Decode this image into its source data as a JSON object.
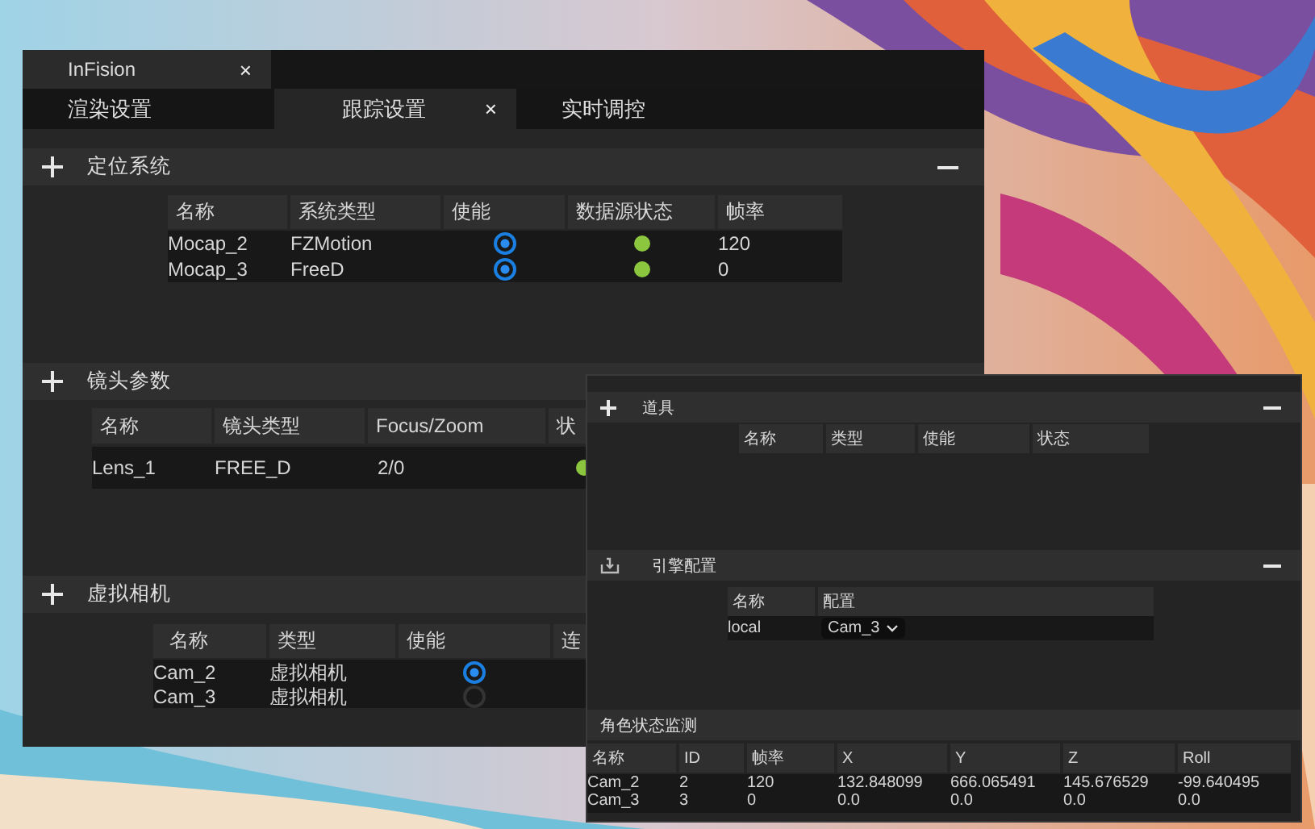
{
  "window": {
    "tab": {
      "label": "InFision",
      "close": "×"
    },
    "tabs": [
      {
        "label": "渲染设置",
        "selected": false
      },
      {
        "label": "跟踪设置",
        "selected": true,
        "close": "×"
      },
      {
        "label": "实时调控",
        "selected": false
      }
    ],
    "sections": [
      {
        "kind": "positioning",
        "title": "定位系统",
        "table": {
          "columns": [
            "名称",
            "系统类型",
            "使能",
            "数据源状态",
            "帧率"
          ],
          "rows": [
            {
              "cells": [
                {
                  "kind": "text",
                  "text": "Mocap_2"
                },
                {
                  "kind": "text",
                  "text": "FZMotion"
                },
                {
                  "kind": "radio",
                  "on": true
                },
                {
                  "kind": "dot",
                  "color": "#8cc63f"
                },
                {
                  "kind": "text",
                  "text": "120"
                }
              ]
            },
            {
              "cells": [
                {
                  "kind": "text",
                  "text": "Mocap_3"
                },
                {
                  "kind": "text",
                  "text": "FreeD"
                },
                {
                  "kind": "radio",
                  "on": true
                },
                {
                  "kind": "dot",
                  "color": "#8cc63f"
                },
                {
                  "kind": "text",
                  "text": "0"
                }
              ]
            }
          ]
        }
      },
      {
        "kind": "lens",
        "title": "镜头参数",
        "table": {
          "columns": [
            "名称",
            "镜头类型",
            "Focus/Zoom",
            "状"
          ],
          "rows": [
            {
              "cells": [
                {
                  "kind": "text",
                  "text": "Lens_1"
                },
                {
                  "kind": "text",
                  "text": "FREE_D"
                },
                {
                  "kind": "text",
                  "text": "2/0"
                },
                {
                  "kind": "dot",
                  "color": "#8cc63f"
                }
              ]
            }
          ]
        }
      },
      {
        "kind": "camera",
        "title": "虚拟相机",
        "table": {
          "columns": [
            "名称",
            "类型",
            "使能",
            "连"
          ],
          "rows": [
            {
              "cells": [
                {
                  "kind": "text",
                  "text": "Cam_2"
                },
                {
                  "kind": "text",
                  "text": "虚拟相机"
                },
                {
                  "kind": "radio",
                  "on": true
                }
              ]
            },
            {
              "cells": [
                {
                  "kind": "text",
                  "text": "Cam_3"
                },
                {
                  "kind": "text",
                  "text": "虚拟相机"
                },
                {
                  "kind": "radio",
                  "on": false
                }
              ]
            }
          ]
        }
      }
    ]
  },
  "panel": {
    "sections": [
      {
        "kind": "props",
        "title": "道具",
        "table": {
          "columns": [
            "名称",
            "类型",
            "使能",
            "状态"
          ]
        }
      },
      {
        "kind": "engine",
        "title": "引擎配置",
        "table": {
          "columns": [
            "名称",
            "配置"
          ],
          "rows": [
            {
              "cells": [
                {
                  "kind": "text",
                  "text": "local"
                },
                {
                  "kind": "dropdown",
                  "value": "Cam_3"
                }
              ]
            }
          ]
        }
      },
      {
        "kind": "monitor",
        "title": "角色状态监测",
        "table": {
          "columns": [
            "名称",
            "ID",
            "帧率",
            "X",
            "Y",
            "Z",
            "Roll"
          ],
          "rows": [
            {
              "cells": [
                {
                  "kind": "text",
                  "text": "Cam_2"
                },
                {
                  "kind": "text",
                  "text": "2"
                },
                {
                  "kind": "text",
                  "text": "120"
                },
                {
                  "kind": "text",
                  "text": "132.848099"
                },
                {
                  "kind": "text",
                  "text": "666.065491"
                },
                {
                  "kind": "text",
                  "text": "145.676529"
                },
                {
                  "kind": "text",
                  "text": "-99.640495"
                }
              ]
            },
            {
              "cells": [
                {
                  "kind": "text",
                  "text": "Cam_3"
                },
                {
                  "kind": "text",
                  "text": "3"
                },
                {
                  "kind": "text",
                  "text": "0"
                },
                {
                  "kind": "text",
                  "text": "0.0"
                },
                {
                  "kind": "text",
                  "text": "0.0"
                },
                {
                  "kind": "text",
                  "text": "0.0"
                },
                {
                  "kind": "text",
                  "text": "0.0"
                }
              ]
            }
          ]
        }
      }
    ]
  }
}
